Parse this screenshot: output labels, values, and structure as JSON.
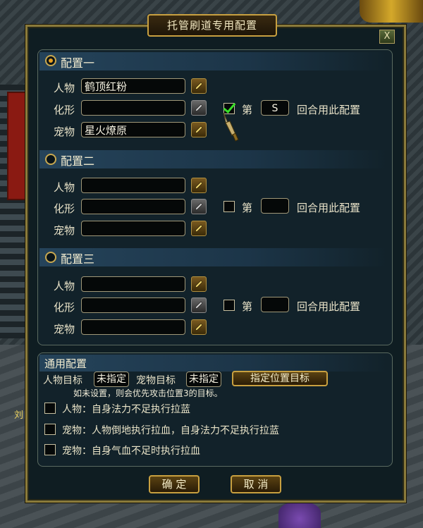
{
  "dialog": {
    "title": "托管刷道专用配置",
    "close_label": "X"
  },
  "configs": [
    {
      "title": "配置一",
      "selected": true,
      "labels": {
        "character": "人物",
        "transform": "化形",
        "pet": "宠物"
      },
      "character_value": "鹤顶红粉",
      "transform_value": "",
      "pet_value": "星火燎原",
      "round_checked": true,
      "round_prefix": "第",
      "round_value": "S",
      "round_suffix": "回合用此配置"
    },
    {
      "title": "配置二",
      "selected": false,
      "labels": {
        "character": "人物",
        "transform": "化形",
        "pet": "宠物"
      },
      "character_value": "",
      "transform_value": "",
      "pet_value": "",
      "round_checked": false,
      "round_prefix": "第",
      "round_value": "",
      "round_suffix": "回合用此配置"
    },
    {
      "title": "配置三",
      "selected": false,
      "labels": {
        "character": "人物",
        "transform": "化形",
        "pet": "宠物"
      },
      "character_value": "",
      "transform_value": "",
      "pet_value": "",
      "round_checked": false,
      "round_prefix": "第",
      "round_value": "",
      "round_suffix": "回合用此配置"
    }
  ],
  "general": {
    "title": "通用配置",
    "char_target_label": "人物目标",
    "char_target_value": "未指定",
    "pet_target_label": "宠物目标",
    "pet_target_value": "未指定",
    "assign_button": "指定位置目标",
    "hint": "如未设置，则会优先攻击位置3的目标。",
    "options": [
      {
        "checked": false,
        "text": "人物：自身法力不足执行拉蓝"
      },
      {
        "checked": false,
        "text": "宠物：人物倒地执行拉血，自身法力不足执行拉蓝"
      },
      {
        "checked": false,
        "text": "宠物：自身气血不足时执行拉血"
      }
    ]
  },
  "buttons": {
    "confirm": "确 定",
    "cancel": "取 消"
  },
  "background": {
    "side_text": "刘"
  },
  "colors": {
    "accent_gold": "#c8a040",
    "check_green": "#38e028",
    "panel_bg": "#12222a"
  }
}
